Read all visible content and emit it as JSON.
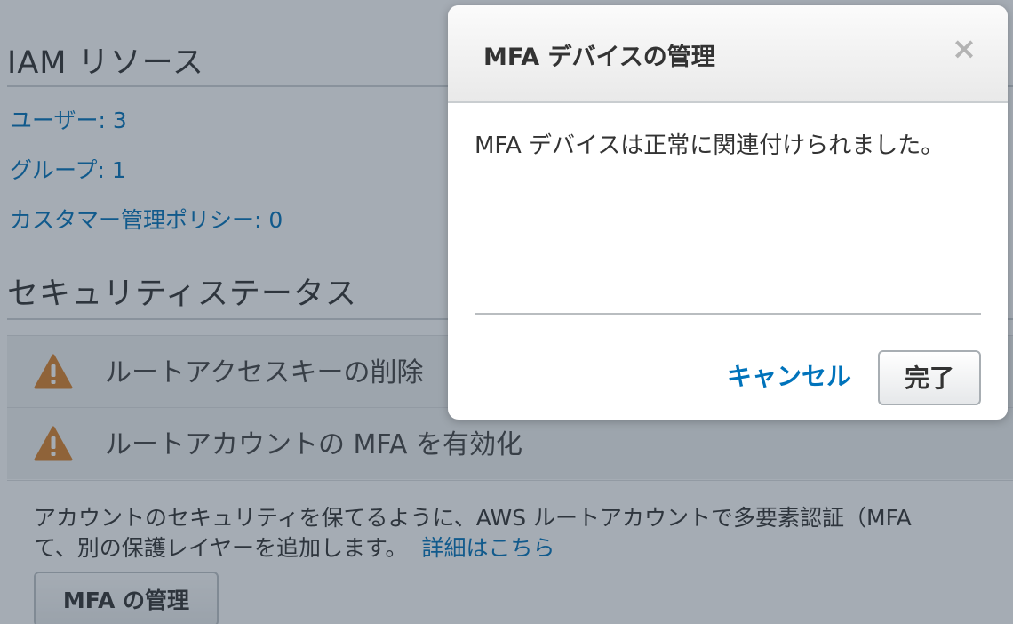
{
  "background": {
    "iam_resources": {
      "title": "IAM リソース",
      "links": [
        {
          "label": "ユーザー: 3"
        },
        {
          "label": "グループ: 1"
        },
        {
          "label": "カスタマー管理ポリシー: 0"
        }
      ]
    },
    "security_status": {
      "title": "セキュリティステータス",
      "items": [
        {
          "label": "ルートアクセスキーの削除",
          "icon": "warning-icon"
        },
        {
          "label": "ルートアカウントの MFA を有効化",
          "icon": "warning-icon"
        }
      ],
      "description_line1": "アカウントのセキュリティを保てるように、AWS ルートアカウントで多要素認証（MFA",
      "description_line2": "て、別の保護レイヤーを追加します。",
      "detail_link": "詳細はこちら",
      "manage_button": "MFA の管理"
    }
  },
  "modal": {
    "title": "MFA デバイスの管理",
    "close_icon": "close-icon",
    "message": "MFA デバイスは正常に関連付けられました。",
    "cancel_label": "キャンセル",
    "done_label": "完了"
  },
  "colors": {
    "link": "#0073bb",
    "warning": "#d9822b",
    "overlay": "rgba(40,58,76,0.42)"
  }
}
